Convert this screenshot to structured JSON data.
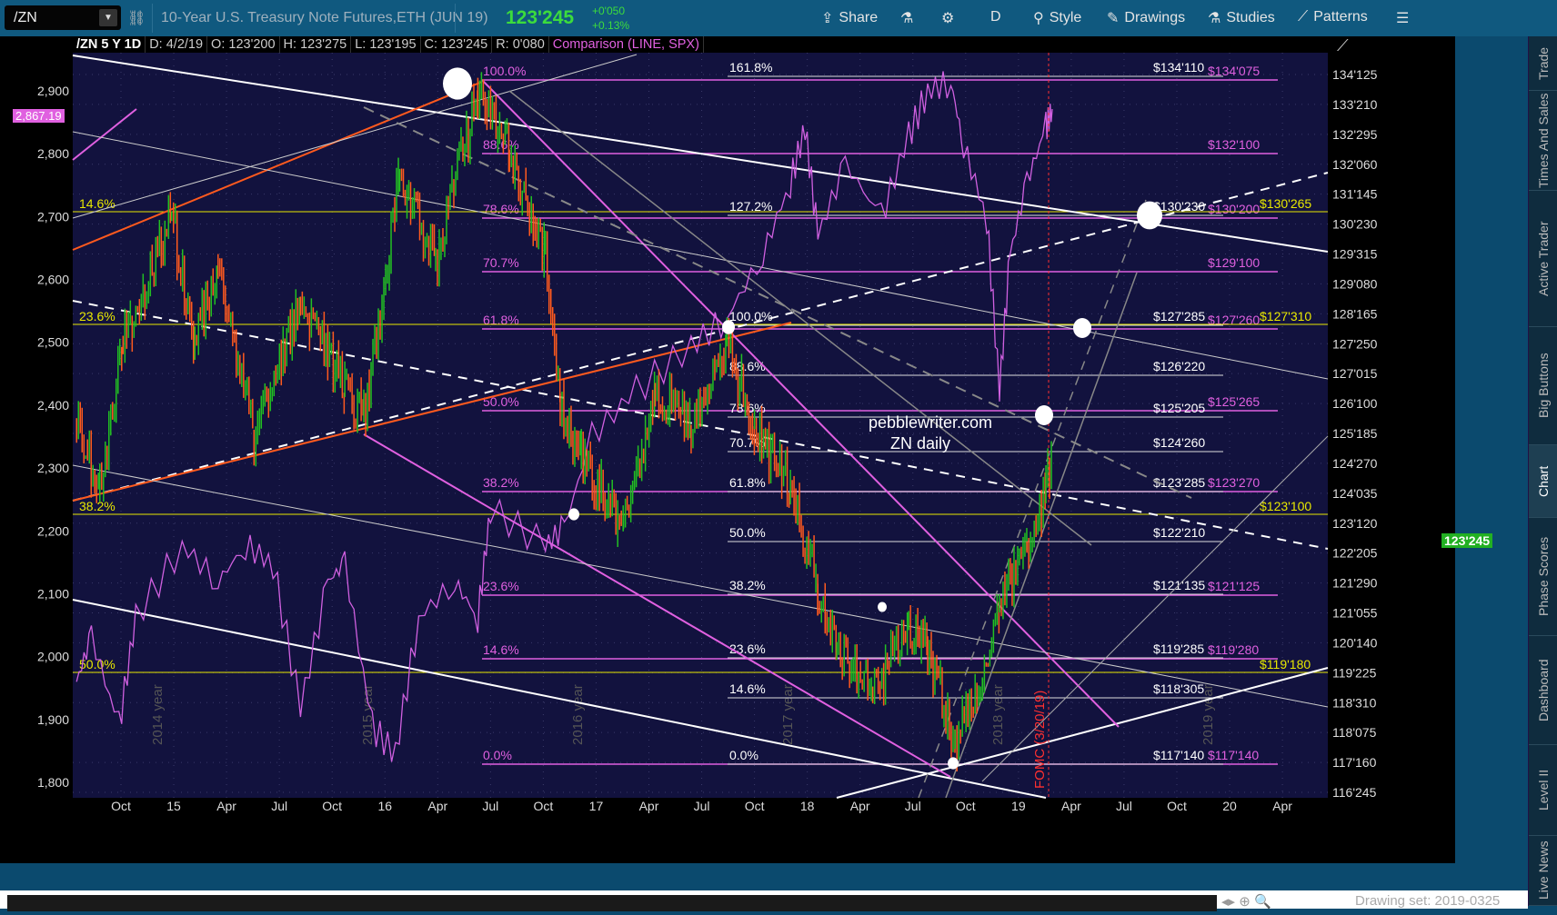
{
  "header": {
    "symbol": "/ZN",
    "description": "10-Year U.S. Treasury Note Futures,ETH (JUN 19)",
    "last": "123'245",
    "change": "+0'050",
    "change_pct": "+0.13%",
    "toolbar": [
      {
        "label": "Share",
        "icon": "share-icon"
      },
      {
        "label": "",
        "icon": "flask-icon"
      },
      {
        "label": "",
        "icon": "gear-icon"
      },
      {
        "label": "D",
        "icon": ""
      },
      {
        "label": "Style",
        "icon": "style-icon"
      },
      {
        "label": "Drawings",
        "icon": "pencil-icon"
      },
      {
        "label": "Studies",
        "icon": "flask-icon"
      },
      {
        "label": "Patterns",
        "icon": "patterns-icon"
      }
    ]
  },
  "infobar": {
    "title": "/ZN 5 Y 1D",
    "date": "D: 4/2/19",
    "open": "O: 123'200",
    "high": "H: 123'275",
    "low": "L: 123'195",
    "close": "C: 123'245",
    "range": "R: 0'080",
    "comparison": "Comparison (LINE, SPX)"
  },
  "right_nav": [
    "Trade",
    "Times And Sales",
    "Active Trader",
    "Big Buttons",
    "Chart",
    "Phase Scores",
    "Dashboard",
    "Level II",
    "Live News"
  ],
  "right_nav_active": "Chart",
  "footer": {
    "drawing_set": "Drawing set: 2019-0325"
  },
  "chart_data": {
    "type": "line",
    "title": "/ZN 5 Y 1D",
    "price_badge": "123'245",
    "spx_badge": "2,867.19",
    "right_axis_ticks": [
      "134'125",
      "133'210",
      "132'295",
      "132'060",
      "131'145",
      "130'230",
      "129'315",
      "129'080",
      "128'165",
      "127'250",
      "127'015",
      "126'100",
      "125'185",
      "124'270",
      "124'035",
      "123'120",
      "122'205",
      "121'290",
      "121'055",
      "120'140",
      "119'225",
      "118'310",
      "118'075",
      "117'160",
      "116'245"
    ],
    "left_axis_ticks": [
      "2,900",
      "2,800",
      "2,700",
      "2,600",
      "2,500",
      "2,400",
      "2,300",
      "2,200",
      "2,100",
      "2,000",
      "1,900",
      "1,800"
    ],
    "left_ylim": [
      1800,
      2900
    ],
    "x_ticks": [
      "Oct",
      "15",
      "Apr",
      "Jul",
      "Oct",
      "16",
      "Apr",
      "Jul",
      "Oct",
      "17",
      "Apr",
      "Jul",
      "Oct",
      "18",
      "Apr",
      "Jul",
      "Oct",
      "19",
      "Apr",
      "Jul",
      "Oct",
      "20",
      "Apr"
    ],
    "year_watermarks": [
      "2014 year",
      "2015 year",
      "2016 year",
      "2017 year",
      "2018 year",
      "2019 year"
    ],
    "annotations": {
      "fomc": "FOMC (3/20/19)",
      "site": "pebblewriter.com",
      "subtitle": "ZN daily"
    },
    "zn_series": {
      "name": "/ZN",
      "t": [
        2014.54,
        2014.65,
        2014.76,
        2014.99,
        2015.1,
        2015.21,
        2015.38,
        2015.6,
        2015.81,
        2015.9,
        2016.07,
        2016.24,
        2016.44,
        2016.59,
        2016.76,
        2016.83,
        2016.93,
        2017.13,
        2017.28,
        2017.45,
        2017.62,
        2017.75,
        2017.92,
        2018.05,
        2018.14,
        2018.31,
        2018.48,
        2018.57,
        2018.7,
        2018.83,
        2018.91,
        2019.04,
        2019.13,
        2019.16
      ],
      "close": [
        125.73,
        124.17,
        127.74,
        130.86,
        127.74,
        129.75,
        125.51,
        128.85,
        126.62,
        125.95,
        131.76,
        129.75,
        133.99,
        132.43,
        129.97,
        126.4,
        124.84,
        123.27,
        126.62,
        125.73,
        127.74,
        125.73,
        124.17,
        121.71,
        120.15,
        119.26,
        120.82,
        120.37,
        117.92,
        119.48,
        121.49,
        122.83,
        124.17,
        125.06
      ]
    },
    "spx_series": {
      "name": "SPX",
      "t": [
        2014.54,
        2014.61,
        2014.74,
        2014.82,
        2015.04,
        2015.21,
        2015.34,
        2015.47,
        2015.6,
        2015.73,
        2015.81,
        2015.94,
        2016.05,
        2016.16,
        2016.33,
        2016.44,
        2016.5,
        2016.76,
        2016.85,
        2016.98,
        2017.19,
        2017.45,
        2017.62,
        2017.79,
        2017.92,
        2017.99,
        2018.05,
        2018.18,
        2018.35,
        2018.48,
        2018.57,
        2018.68,
        2018.74,
        2018.85,
        2018.91,
        2018.96,
        2019.04,
        2019.13,
        2019.16
      ],
      "values": [
        1960,
        2033,
        1888,
        2062,
        2177,
        2119,
        2177,
        2148,
        1917,
        2119,
        2148,
        1888,
        1845,
        2062,
        2119,
        2062,
        2235,
        2177,
        2206,
        2351,
        2423,
        2495,
        2539,
        2640,
        2755,
        2842,
        2669,
        2784,
        2698,
        2828,
        2900,
        2914,
        2813,
        2698,
        2423,
        2640,
        2755,
        2842,
        2871
      ]
    },
    "fib_pink": [
      {
        "pct": "100.0%",
        "price": "$134'075"
      },
      {
        "pct": "88.6%",
        "price": "$132'100"
      },
      {
        "pct": "78.6%",
        "price": "$130'200"
      },
      {
        "pct": "70.7%",
        "price": "$129'100"
      },
      {
        "pct": "61.8%",
        "price": "$127'260"
      },
      {
        "pct": "50.0%",
        "price": "$125'265"
      },
      {
        "pct": "38.2%",
        "price": "$123'270"
      },
      {
        "pct": "23.6%",
        "price": "$121'125"
      },
      {
        "pct": "14.6%",
        "price": "$119'280"
      },
      {
        "pct": "0.0%",
        "price": "$117'140"
      }
    ],
    "fib_white": [
      {
        "pct": "161.8%",
        "price": "$134'110"
      },
      {
        "pct": "127.2%",
        "price": "$130'230"
      },
      {
        "pct": "100.0%",
        "price": "$127'285"
      },
      {
        "pct": "88.6%",
        "price": "$126'220"
      },
      {
        "pct": "78.6%",
        "price": "$125'205"
      },
      {
        "pct": "70.7%",
        "price": "$124'260"
      },
      {
        "pct": "61.8%",
        "price": "$123'285"
      },
      {
        "pct": "50.0%",
        "price": "$122'210"
      },
      {
        "pct": "38.2%",
        "price": "$121'135"
      },
      {
        "pct": "23.6%",
        "price": "$119'285"
      },
      {
        "pct": "14.6%",
        "price": "$118'305"
      },
      {
        "pct": "0.0%",
        "price": "$117'140"
      }
    ],
    "fib_yellow": [
      {
        "pct": "14.6%",
        "price": "$130'265"
      },
      {
        "pct": "23.6%",
        "price": "$127'310"
      },
      {
        "pct": "38.2%",
        "price": "$123'100"
      },
      {
        "pct": "50.0%",
        "price": "$119'180"
      }
    ],
    "colors": {
      "up": "#22c022",
      "down": "#ff5a1e",
      "spx": "#d060e0",
      "pink": "#e060e0",
      "yellow": "#e8e800",
      "bg": "#12123e"
    }
  }
}
